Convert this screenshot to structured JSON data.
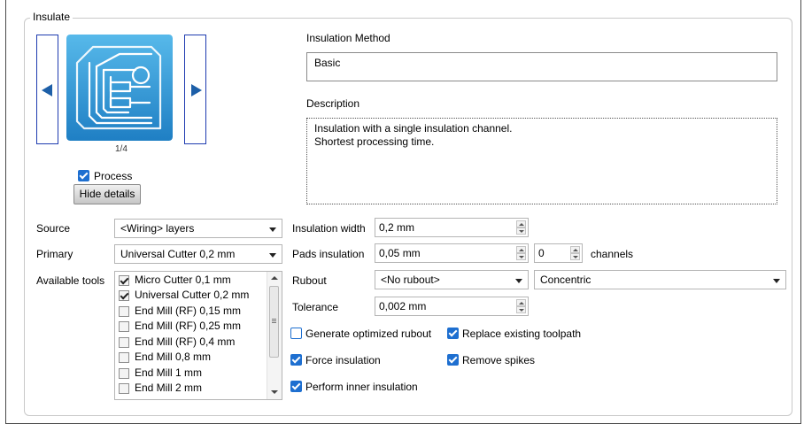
{
  "group": {
    "title": "Insulate"
  },
  "preview": {
    "page_indicator": "1/4",
    "icon": "circuit-board-icon"
  },
  "process_checkbox": {
    "label": "Process",
    "checked": true
  },
  "hide_details_button": "Hide details",
  "method": {
    "label": "Insulation Method",
    "value": "Basic"
  },
  "description": {
    "label": "Description",
    "lines": [
      "Insulation with a single insulation channel.",
      "Shortest processing time."
    ]
  },
  "source": {
    "label": "Source",
    "value": "<Wiring> layers"
  },
  "primary": {
    "label": "Primary",
    "value": "Universal Cutter 0,2 mm"
  },
  "available_tools": {
    "label": "Available tools",
    "items": [
      {
        "label": "Micro Cutter 0,1 mm",
        "checked": true
      },
      {
        "label": "Universal Cutter 0,2 mm",
        "checked": true
      },
      {
        "label": "End Mill (RF) 0,15 mm",
        "checked": false
      },
      {
        "label": "End Mill (RF) 0,25 mm",
        "checked": false
      },
      {
        "label": "End Mill (RF) 0,4 mm",
        "checked": false
      },
      {
        "label": "End Mill 0,8 mm",
        "checked": false
      },
      {
        "label": "End Mill 1 mm",
        "checked": false
      },
      {
        "label": "End Mill 2 mm",
        "checked": false
      }
    ]
  },
  "insulation_width": {
    "label": "Insulation width",
    "value": "0,2 mm"
  },
  "pads_insulation": {
    "label": "Pads insulation",
    "value": "0,05 mm",
    "channels_value": "0",
    "channels_label": "channels"
  },
  "rubout": {
    "label": "Rubout",
    "value": "<No rubout>",
    "pattern": "Concentric"
  },
  "tolerance": {
    "label": "Tolerance",
    "value": "0,002 mm"
  },
  "options": {
    "generate_optimized_rubout": {
      "label": "Generate optimized rubout",
      "checked": false
    },
    "replace_existing_toolpath": {
      "label": "Replace existing toolpath",
      "checked": true
    },
    "force_insulation": {
      "label": "Force insulation",
      "checked": true
    },
    "remove_spikes": {
      "label": "Remove spikes",
      "checked": true
    },
    "perform_inner_insulation": {
      "label": "Perform inner insulation",
      "checked": true
    }
  },
  "colors": {
    "accent": "#1e6fd0",
    "nav_border": "#1e3bb0",
    "preview_bg": "#3aa3dc"
  }
}
